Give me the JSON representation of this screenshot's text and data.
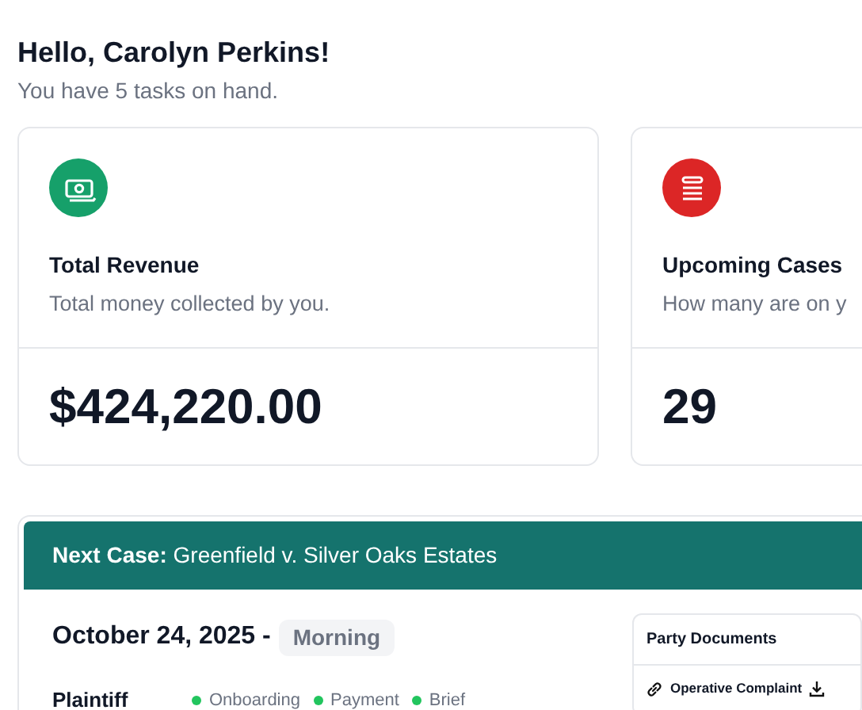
{
  "greeting": {
    "title": "Hello, Carolyn Perkins!",
    "subtitle": "You have 5 tasks on hand."
  },
  "stats": [
    {
      "kind": "money",
      "color": "#16a06a",
      "title": "Total Revenue",
      "description": "Total money collected by you.",
      "value": "$424,220.00"
    },
    {
      "kind": "list",
      "color": "#dc2626",
      "title": "Upcoming Cases",
      "description": "How many are on y",
      "value": "29"
    }
  ],
  "next_case": {
    "label": "Next Case:",
    "name": "Greenfield v. Silver Oaks Estates",
    "date": "October 24, 2025 -",
    "time_badge": "Morning",
    "parties": [
      {
        "role": "Plaintiff",
        "steps": [
          {
            "label": "Onboarding",
            "color": "#22c55e"
          },
          {
            "label": "Payment",
            "color": "#22c55e"
          },
          {
            "label": "Brief",
            "color": "#22c55e"
          }
        ]
      }
    ],
    "documents": {
      "title": "Party Documents",
      "items": [
        {
          "label": "Operative Complaint"
        }
      ]
    }
  }
}
